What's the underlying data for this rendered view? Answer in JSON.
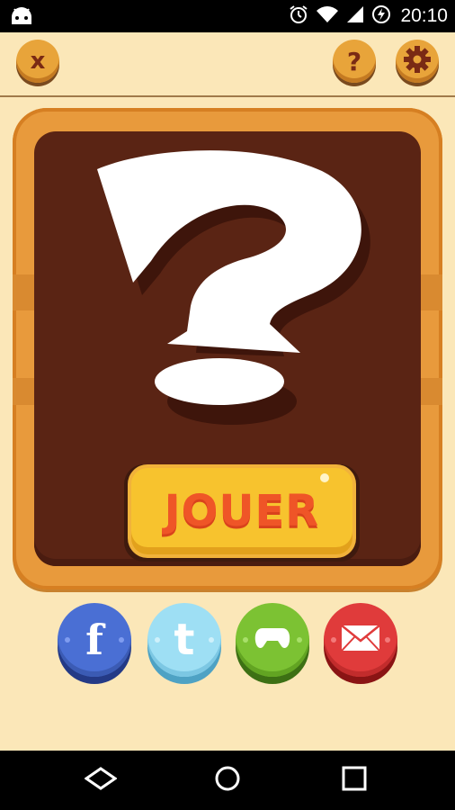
{
  "status_bar": {
    "time": "20:10",
    "icons": [
      "android-icon",
      "alarm-icon",
      "wifi-icon",
      "signal-icon",
      "battery-charging-icon"
    ]
  },
  "top_bar": {
    "close_label": "x",
    "help_label": "?",
    "settings_icon": "gear-icon"
  },
  "board": {
    "emblem_icon": "question-mark-icon",
    "play_label": "JOUER"
  },
  "share": [
    {
      "name": "facebook",
      "icon": "facebook-icon",
      "label": "f",
      "color": "#4a6fd4"
    },
    {
      "name": "twitter",
      "icon": "twitter-icon",
      "label": "t",
      "color": "#9edff4"
    },
    {
      "name": "games",
      "icon": "gamepad-icon",
      "color": "#7cc233"
    },
    {
      "name": "mail",
      "icon": "mail-icon",
      "color": "#e03b3b"
    }
  ],
  "nav_bar": {
    "icons": [
      "back-icon",
      "home-icon",
      "recents-icon"
    ]
  },
  "colors": {
    "background": "#fbe7b8",
    "wood": "#e89a3c",
    "board": "#5a2414",
    "play_button": "#f7c32e",
    "play_text": "#ef5527"
  }
}
